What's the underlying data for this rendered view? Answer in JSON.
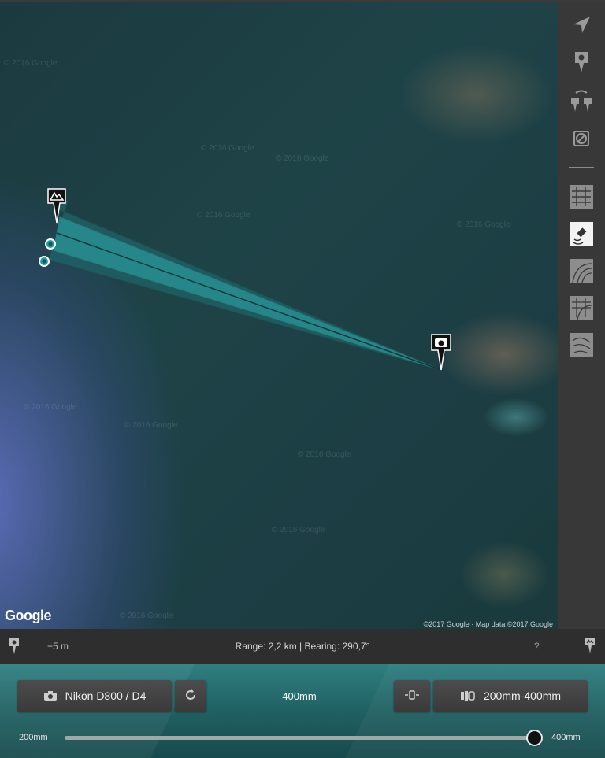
{
  "map": {
    "provider_logo": "Google",
    "attribution": "©2017 Google · Map data ©2017 Google",
    "watermark": "© 2016 Google"
  },
  "sidebar": {
    "icons": [
      "navigation-arrow-icon",
      "add-pin-icon",
      "swap-pins-icon",
      "clear-icon"
    ],
    "map_types": [
      "streets-icon",
      "satellite-icon",
      "terrain-icon",
      "hybrid-icon",
      "topo-icon"
    ],
    "active_map_type": "satellite-icon"
  },
  "infobar": {
    "elevation_offset": "+5 m",
    "range_bearing": "Range: 2,2 km | Bearing: 290,7°",
    "help": "?"
  },
  "panel": {
    "camera_label": "Nikon D800 / D4",
    "focal_length": "400mm",
    "lens_label": "200mm-400mm",
    "slider_min": "200mm",
    "slider_max": "400mm",
    "slider_value_fraction": 1.0
  },
  "colors": {
    "accent_teal": "#2f7f80",
    "beam_fill": "#2a9a9c",
    "sidebar_bg": "#383838"
  }
}
